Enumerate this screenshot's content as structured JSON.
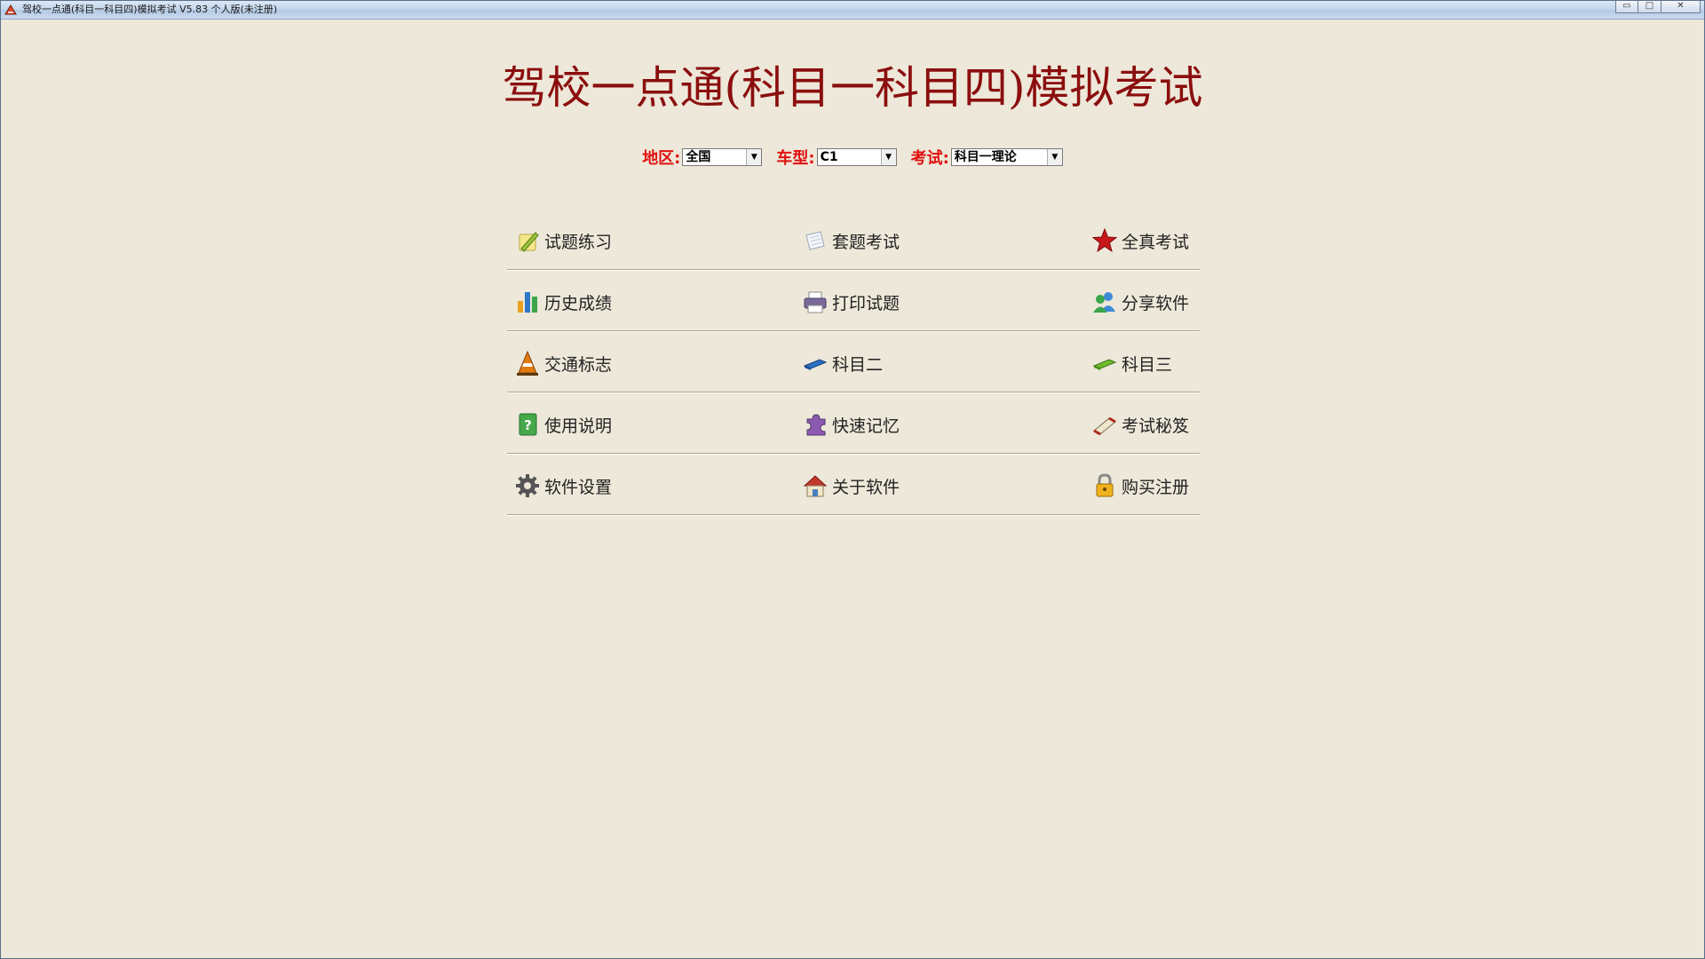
{
  "window": {
    "title": "驾校一点通(科目一科目四)模拟考试 V5.83 个人版(未注册)",
    "minimize_label": "▭",
    "maximize_label": "□",
    "close_label": "✕"
  },
  "header": {
    "title": "驾校一点通(科目一科目四)模拟考试"
  },
  "filters": {
    "region": {
      "label": "地区:",
      "value": "全国"
    },
    "vehicle": {
      "label": "车型:",
      "value": "C1"
    },
    "exam": {
      "label": "考试:",
      "value": "科目一理论"
    }
  },
  "menu": [
    [
      {
        "label": "试题练习",
        "icon": "pencil-note-icon"
      },
      {
        "label": "套题考试",
        "icon": "paper-sheet-icon"
      },
      {
        "label": "全真考试",
        "icon": "star-icon"
      }
    ],
    [
      {
        "label": "历史成绩",
        "icon": "bar-chart-icon"
      },
      {
        "label": "打印试题",
        "icon": "printer-icon"
      },
      {
        "label": "分享软件",
        "icon": "users-icon"
      }
    ],
    [
      {
        "label": "交通标志",
        "icon": "traffic-cone-icon"
      },
      {
        "label": "科目二",
        "icon": "blue-eraser-icon"
      },
      {
        "label": "科目三",
        "icon": "green-eraser-icon"
      }
    ],
    [
      {
        "label": "使用说明",
        "icon": "help-book-icon"
      },
      {
        "label": "快速记忆",
        "icon": "puzzle-icon"
      },
      {
        "label": "考试秘笈",
        "icon": "scroll-icon"
      }
    ],
    [
      {
        "label": "软件设置",
        "icon": "gear-icon"
      },
      {
        "label": "关于软件",
        "icon": "house-icon"
      },
      {
        "label": "购买注册",
        "icon": "lock-icon"
      }
    ]
  ],
  "colors": {
    "title": "#8b0e0e",
    "filter_label": "#e01010",
    "background": "#ede8d9"
  }
}
